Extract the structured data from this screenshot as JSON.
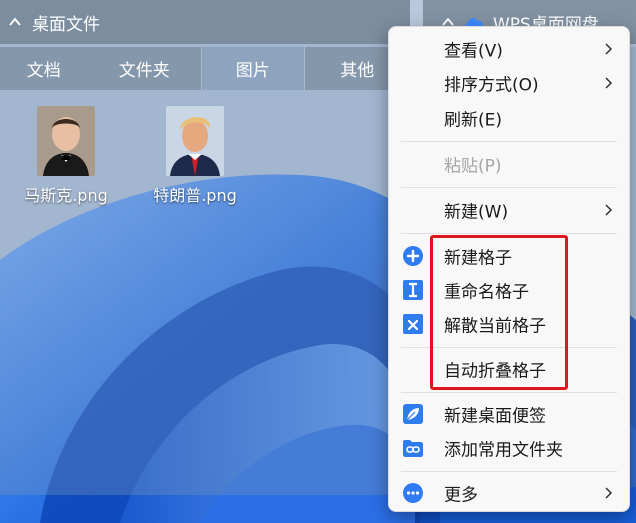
{
  "desktop_panel": {
    "title": "桌面文件",
    "tabs": [
      {
        "label": "文档",
        "active": false
      },
      {
        "label": "文件夹",
        "active": false
      },
      {
        "label": "图片",
        "active": true
      },
      {
        "label": "其他",
        "active": false
      }
    ],
    "files": [
      {
        "name": "马斯克.png",
        "icon": "portrait-image"
      },
      {
        "name": "特朗普.png",
        "icon": "portrait-image"
      }
    ]
  },
  "cloud_panel": {
    "title": "WPS桌面网盘"
  },
  "context_menu": {
    "items": [
      {
        "label": "查看(V)",
        "submenu": true
      },
      {
        "label": "排序方式(O)",
        "submenu": true
      },
      {
        "label": "刷新(E)"
      },
      {
        "label": "粘贴(P)",
        "disabled": true
      },
      {
        "label": "新建(W)",
        "submenu": true
      },
      {
        "label": "新建格子",
        "icon": "plus-circle-icon"
      },
      {
        "label": "重命名格子",
        "icon": "text-cursor-icon"
      },
      {
        "label": "解散当前格子",
        "icon": "close-box-icon"
      },
      {
        "label": "自动折叠格子"
      },
      {
        "label": "新建桌面便签",
        "icon": "leaf-note-icon"
      },
      {
        "label": "添加常用文件夹",
        "icon": "folder-link-icon"
      },
      {
        "label": "更多",
        "icon": "more-circle-icon",
        "submenu": true
      }
    ]
  },
  "colors": {
    "accent_blue": "#2f7bf2",
    "highlight_red": "#e0161c"
  }
}
